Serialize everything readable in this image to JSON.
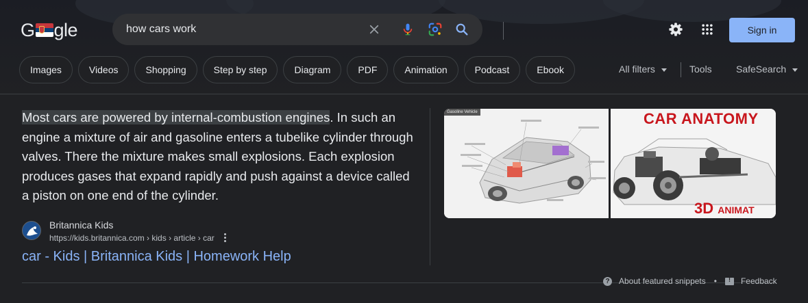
{
  "search": {
    "query": "how cars work"
  },
  "header": {
    "signin_label": "Sign in"
  },
  "chips": [
    {
      "label": "Images"
    },
    {
      "label": "Videos"
    },
    {
      "label": "Shopping"
    },
    {
      "label": "Step by step"
    },
    {
      "label": "Diagram"
    },
    {
      "label": "PDF"
    },
    {
      "label": "Animation"
    },
    {
      "label": "Podcast"
    },
    {
      "label": "Ebook"
    }
  ],
  "tools": {
    "all_filters": "All filters",
    "tools": "Tools",
    "safesearch": "SafeSearch"
  },
  "snippet": {
    "highlight": "Most cars are powered by internal-combustion engines",
    "rest": ". In such an engine a mixture of air and gasoline enters a tubelike cylinder through valves. There the mixture makes small explosions. Each explosion produces gases that expand rapidly and push against a device called a piston on one end of the cylinder."
  },
  "source": {
    "name": "Britannica Kids",
    "url": "https://kids.britannica.com › kids › article › car",
    "link_title": "car - Kids | Britannica Kids | Homework Help"
  },
  "images": {
    "thumb1_tag": "Gasoline Vehicle",
    "thumb2_title": "CAR ANATOMY",
    "thumb2_sub_big": "3D",
    "thumb2_sub_small": "ANIMAT"
  },
  "footer": {
    "about": "About featured snippets",
    "separator": "•",
    "feedback": "Feedback"
  },
  "colors": {
    "background": "#202124",
    "link": "#8ab4f8",
    "signin_bg": "#8ab4f8"
  }
}
